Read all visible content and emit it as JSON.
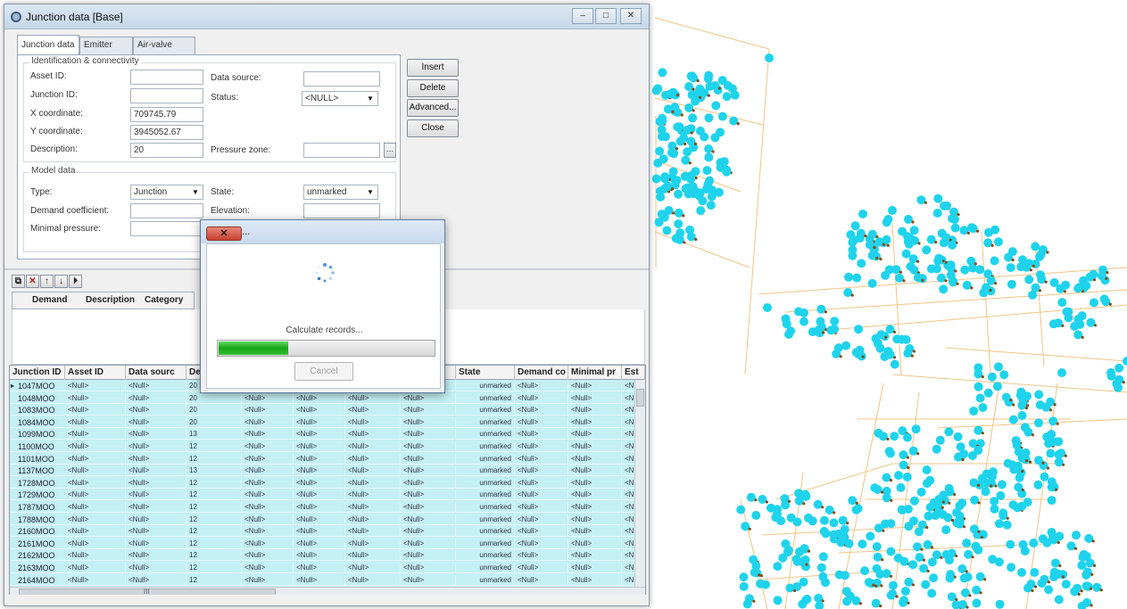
{
  "window": {
    "title": "Junction data [Base]",
    "controls": {
      "minimize": "–",
      "maximize": "□",
      "close": "✕"
    }
  },
  "tabs": [
    {
      "label": "Junction data"
    },
    {
      "label": "Emitter data"
    },
    {
      "label": "Air-valve data"
    }
  ],
  "identification": {
    "group_title": "Identification & connectivity",
    "asset_id": {
      "label": "Asset ID:",
      "value": ""
    },
    "junction_id": {
      "label": "Junction ID:",
      "value": ""
    },
    "x_coordinate": {
      "label": "X coordinate:",
      "value": "709745.79"
    },
    "y_coordinate": {
      "label": "Y coordinate:",
      "value": "3945052.67"
    },
    "description": {
      "label": "Description:",
      "value": "20"
    },
    "data_source": {
      "label": "Data source:",
      "value": ""
    },
    "status": {
      "label": "Status:",
      "value": "<NULL>"
    },
    "pressure_zone": {
      "label": "Pressure zone:",
      "value": ""
    }
  },
  "model": {
    "group_title": "Model data",
    "type": {
      "label": "Type:",
      "value": "Junction"
    },
    "demand_coefficient": {
      "label": "Demand coefficient:",
      "value": ""
    },
    "minimal_pressure": {
      "label": "Minimal pressure:",
      "value": ""
    },
    "state": {
      "label": "State:",
      "value": "unmarked"
    },
    "elevation": {
      "label": "Elevation:",
      "value": ""
    }
  },
  "buttons": {
    "insert": "Insert",
    "delete": "Delete",
    "advanced": "Advanced...",
    "close": "Close"
  },
  "mini_toolbar": {
    "copy": "⧉",
    "delete": "✕",
    "up": "↑",
    "down": "↓",
    "last": "⏵"
  },
  "subgrid": {
    "columns": [
      "Demand",
      "Description",
      "Category"
    ]
  },
  "grid": {
    "columns": [
      "Junction ID",
      "Asset ID",
      "Data sourc",
      "Desc",
      "",
      "",
      "",
      "",
      "State",
      "Demand co",
      "Minimal pr",
      "Est"
    ],
    "rows": [
      {
        "id": "1047MOO",
        "asset": "<Null>",
        "src": "<Null>",
        "desc": "20",
        "c5": "",
        "c6": "",
        "c7": "",
        "c8": "",
        "state": "unmarked",
        "demand": "<Null>",
        "minp": "<Null>",
        "est": "<Nu"
      },
      {
        "id": "1048MOO",
        "asset": "<Null>",
        "src": "<Null>",
        "desc": "20",
        "c5": "<Null>",
        "c6": "<Null>",
        "c7": "<Null>",
        "c8": "<Null>",
        "state": "unmarked",
        "demand": "<Null>",
        "minp": "<Null>",
        "est": "<Nu"
      },
      {
        "id": "1083MOO",
        "asset": "<Null>",
        "src": "<Null>",
        "desc": "20",
        "c5": "<Null>",
        "c6": "<Null>",
        "c7": "<Null>",
        "c8": "<Null>",
        "state": "unmarked",
        "demand": "<Null>",
        "minp": "<Null>",
        "est": "<Nu"
      },
      {
        "id": "1084MOO",
        "asset": "<Null>",
        "src": "<Null>",
        "desc": "20",
        "c5": "<Null>",
        "c6": "<Null>",
        "c7": "<Null>",
        "c8": "<Null>",
        "state": "unmarked",
        "demand": "<Null>",
        "minp": "<Null>",
        "est": "<Nu"
      },
      {
        "id": "1099MOO",
        "asset": "<Null>",
        "src": "<Null>",
        "desc": "13",
        "c5": "<Null>",
        "c6": "<Null>",
        "c7": "<Null>",
        "c8": "<Null>",
        "state": "unmarked",
        "demand": "<Null>",
        "minp": "<Null>",
        "est": "<Nu"
      },
      {
        "id": "1100MOO",
        "asset": "<Null>",
        "src": "<Null>",
        "desc": "12",
        "c5": "<Null>",
        "c6": "<Null>",
        "c7": "<Null>",
        "c8": "<Null>",
        "state": "unmarked",
        "demand": "<Null>",
        "minp": "<Null>",
        "est": "<Nu"
      },
      {
        "id": "1101MOO",
        "asset": "<Null>",
        "src": "<Null>",
        "desc": "12",
        "c5": "<Null>",
        "c6": "<Null>",
        "c7": "<Null>",
        "c8": "<Null>",
        "state": "unmarked",
        "demand": "<Null>",
        "minp": "<Null>",
        "est": "<Nu"
      },
      {
        "id": "1137MOO",
        "asset": "<Null>",
        "src": "<Null>",
        "desc": "13",
        "c5": "<Null>",
        "c6": "<Null>",
        "c7": "<Null>",
        "c8": "<Null>",
        "state": "unmarked",
        "demand": "<Null>",
        "minp": "<Null>",
        "est": "<Nu"
      },
      {
        "id": "1728MOO",
        "asset": "<Null>",
        "src": "<Null>",
        "desc": "12",
        "c5": "<Null>",
        "c6": "<Null>",
        "c7": "<Null>",
        "c8": "<Null>",
        "state": "unmarked",
        "demand": "<Null>",
        "minp": "<Null>",
        "est": "<Nu"
      },
      {
        "id": "1729MOO",
        "asset": "<Null>",
        "src": "<Null>",
        "desc": "12",
        "c5": "<Null>",
        "c6": "<Null>",
        "c7": "<Null>",
        "c8": "<Null>",
        "state": "unmarked",
        "demand": "<Null>",
        "minp": "<Null>",
        "est": "<Nu"
      },
      {
        "id": "1787MOO",
        "asset": "<Null>",
        "src": "<Null>",
        "desc": "12",
        "c5": "<Null>",
        "c6": "<Null>",
        "c7": "<Null>",
        "c8": "<Null>",
        "state": "unmarked",
        "demand": "<Null>",
        "minp": "<Null>",
        "est": "<Nu"
      },
      {
        "id": "1788MOO",
        "asset": "<Null>",
        "src": "<Null>",
        "desc": "12",
        "c5": "<Null>",
        "c6": "<Null>",
        "c7": "<Null>",
        "c8": "<Null>",
        "state": "unmarked",
        "demand": "<Null>",
        "minp": "<Null>",
        "est": "<Nu"
      },
      {
        "id": "2160MOO",
        "asset": "<Null>",
        "src": "<Null>",
        "desc": "12",
        "c5": "<Null>",
        "c6": "<Null>",
        "c7": "<Null>",
        "c8": "<Null>",
        "state": "unmarked",
        "demand": "<Null>",
        "minp": "<Null>",
        "est": "<Nu"
      },
      {
        "id": "2161MOO",
        "asset": "<Null>",
        "src": "<Null>",
        "desc": "12",
        "c5": "<Null>",
        "c6": "<Null>",
        "c7": "<Null>",
        "c8": "<Null>",
        "state": "unmarked",
        "demand": "<Null>",
        "minp": "<Null>",
        "est": "<Nu"
      },
      {
        "id": "2162MOO",
        "asset": "<Null>",
        "src": "<Null>",
        "desc": "12",
        "c5": "<Null>",
        "c6": "<Null>",
        "c7": "<Null>",
        "c8": "<Null>",
        "state": "unmarked",
        "demand": "<Null>",
        "minp": "<Null>",
        "est": "<Nu"
      },
      {
        "id": "2163MOO",
        "asset": "<Null>",
        "src": "<Null>",
        "desc": "12",
        "c5": "<Null>",
        "c6": "<Null>",
        "c7": "<Null>",
        "c8": "<Null>",
        "state": "unmarked",
        "demand": "<Null>",
        "minp": "<Null>",
        "est": "<Nu"
      },
      {
        "id": "2164MOO",
        "asset": "<Null>",
        "src": "<Null>",
        "desc": "12",
        "c5": "<Null>",
        "c6": "<Null>",
        "c7": "<Null>",
        "c8": "<Null>",
        "state": "unmarked",
        "demand": "<Null>",
        "minp": "<Null>",
        "est": "<Nu"
      }
    ],
    "hscroll_marker": "III"
  },
  "progress_dialog": {
    "title": "Working...",
    "message": "Calculate records...",
    "progress": 0.32,
    "cancel_label": "Cancel",
    "close_glyph": "✕"
  },
  "map": {
    "node_color": "#1fd3ec",
    "pipe_color": "#f0c487",
    "valve_color": "#8a4a10"
  }
}
